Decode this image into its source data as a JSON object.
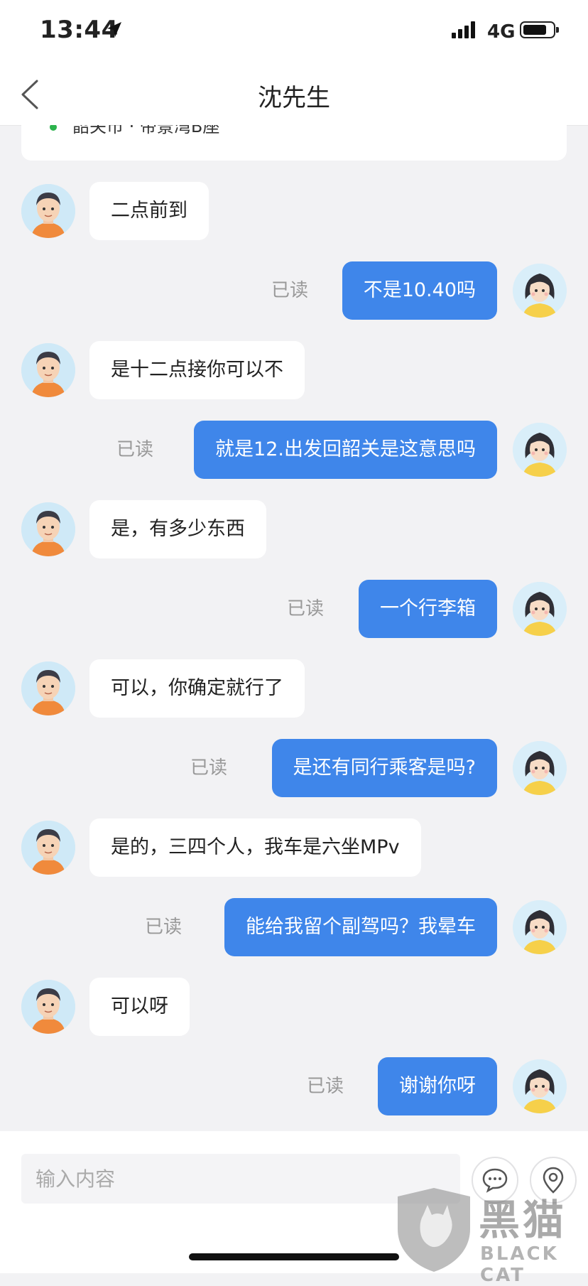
{
  "status_bar": {
    "time": "13:44",
    "network": "4G"
  },
  "header": {
    "title": "沈先生"
  },
  "trip_card": {
    "text": "韶关市 · 帝景湾B座"
  },
  "messages": [
    {
      "side": "in",
      "text": "二点前到"
    },
    {
      "side": "out",
      "text": "不是10.40吗",
      "read": "已读"
    },
    {
      "side": "in",
      "text": "是十二点接你可以不"
    },
    {
      "side": "out",
      "text": "就是12.出发回韶关是这意思吗",
      "read": "已读"
    },
    {
      "side": "in",
      "text": "是，有多少东西"
    },
    {
      "side": "out",
      "text": "一个行李箱",
      "read": "已读"
    },
    {
      "side": "in",
      "text": "可以，你确定就行了"
    },
    {
      "side": "out",
      "text": "是还有同行乘客是吗?",
      "read": "已读"
    },
    {
      "side": "in",
      "text": "是的，三四个人，我车是六坐MPv"
    },
    {
      "side": "out",
      "text": "能给我留个副驾吗？我晕车",
      "read": "已读"
    },
    {
      "side": "in",
      "text": "可以呀"
    },
    {
      "side": "out",
      "text": "谢谢你呀",
      "read": "已读"
    }
  ],
  "input": {
    "placeholder": "输入内容",
    "value": ""
  },
  "watermark": {
    "cn": "黑猫",
    "en": "BLACK CAT"
  },
  "colors": {
    "accent": "#3f86ea",
    "background": "#f2f2f4"
  }
}
